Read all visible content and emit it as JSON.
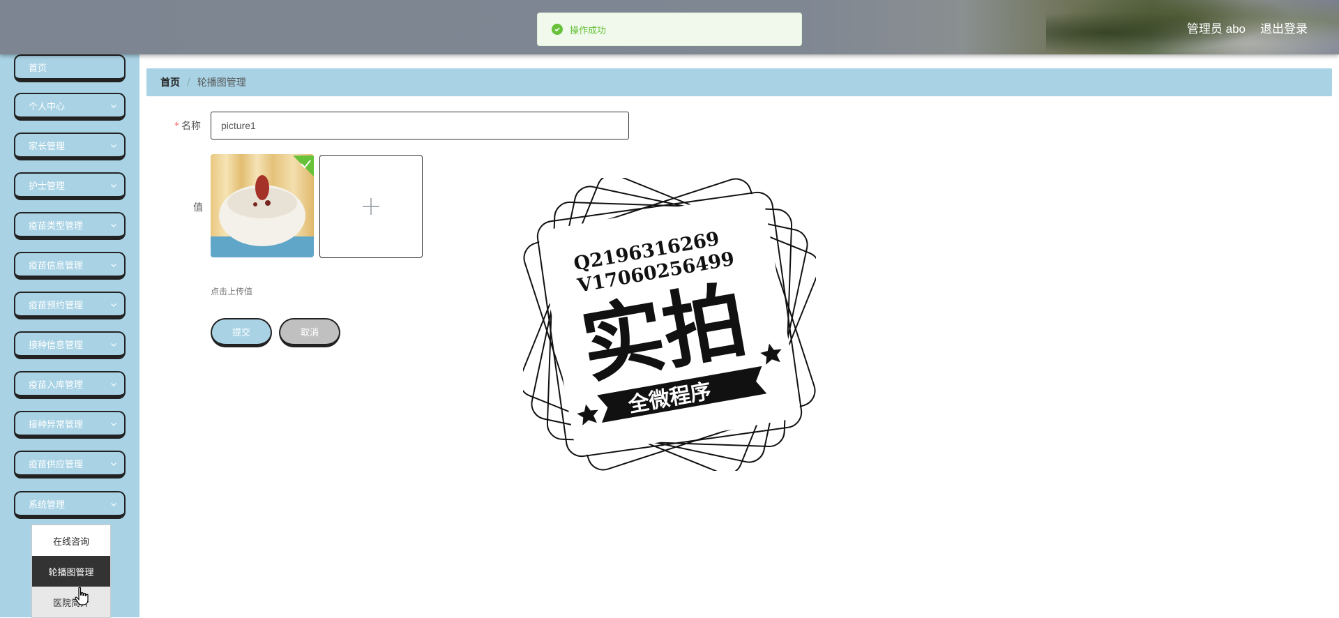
{
  "header": {
    "user_label": "管理员 abo",
    "logout_label": "退出登录"
  },
  "toast": {
    "message": "操作成功",
    "status_color": "#67c23a"
  },
  "sidebar": {
    "items": [
      {
        "label": "首页",
        "has_submenu": false
      },
      {
        "label": "个人中心",
        "has_submenu": true
      },
      {
        "label": "家长管理",
        "has_submenu": true
      },
      {
        "label": "护士管理",
        "has_submenu": true
      },
      {
        "label": "疫苗类型管理",
        "has_submenu": true
      },
      {
        "label": "疫苗信息管理",
        "has_submenu": true
      },
      {
        "label": "疫苗预约管理",
        "has_submenu": true
      },
      {
        "label": "接种信息管理",
        "has_submenu": true
      },
      {
        "label": "疫苗入库管理",
        "has_submenu": true
      },
      {
        "label": "接种异常管理",
        "has_submenu": true
      },
      {
        "label": "疫苗供应管理",
        "has_submenu": true
      },
      {
        "label": "系统管理",
        "has_submenu": true
      }
    ],
    "submenu": [
      {
        "label": "在线咨询",
        "state": "normal"
      },
      {
        "label": "轮播图管理",
        "state": "active"
      },
      {
        "label": "医院简介",
        "state": "hover"
      }
    ]
  },
  "breadcrumb": {
    "home": "首页",
    "separator": "/",
    "current": "轮播图管理"
  },
  "form": {
    "name_label": "名称",
    "name_required_mark": "*",
    "name_value": "picture1",
    "value_label": "值",
    "upload_tip": "点击上传值",
    "submit_label": "提交",
    "cancel_label": "取消"
  },
  "watermark": {
    "line1": "Q2196316269",
    "line2": "V17060256499",
    "main": "实拍",
    "banner": "全微程序"
  },
  "colors": {
    "accent": "#a9d3e5",
    "success": "#67c23a",
    "required": "#f56c6c",
    "active_menu": "#333333"
  }
}
